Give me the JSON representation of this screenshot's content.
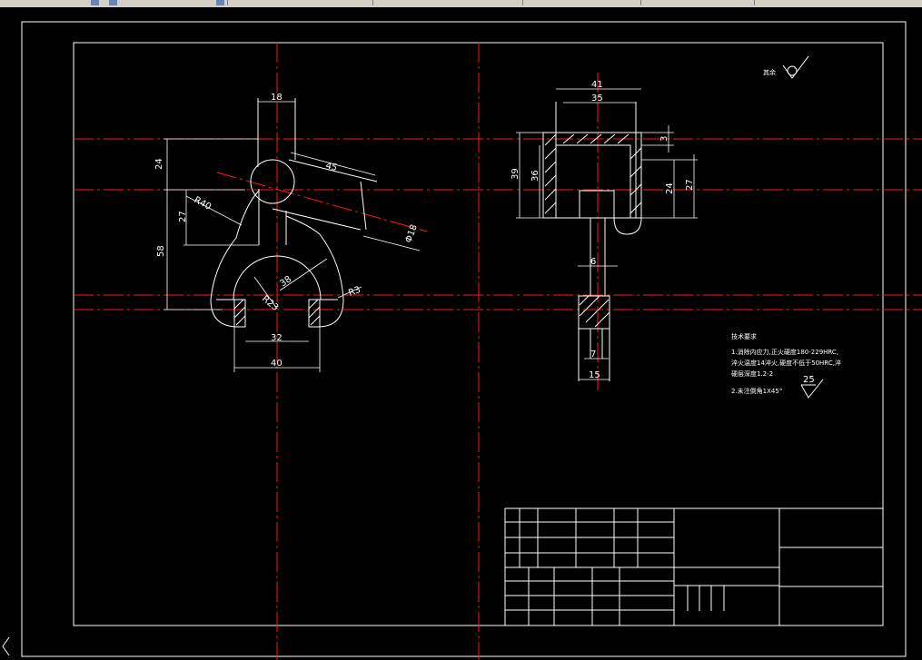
{
  "colors": {
    "background": "#000000",
    "lines": "#ffffff",
    "centerlines": "#ff1a1a",
    "hatch": "#ffffff"
  },
  "front_view": {
    "dims": {
      "d18": "18",
      "d24": "24",
      "d27": "27",
      "d58": "58",
      "d45": "45",
      "r40": "R40",
      "phi18": "Φ18",
      "d38": "38",
      "r23": "R23",
      "r3": "R3",
      "d32": "32",
      "d40": "40"
    }
  },
  "side_view": {
    "dims": {
      "d41": "41",
      "d35": "35",
      "d39": "39",
      "d36": "36",
      "d3": "3",
      "d24": "24",
      "d27": "27",
      "d6": "6",
      "d7": "7",
      "d15": "15"
    }
  },
  "roughness": {
    "label": "其余",
    "value": "25"
  },
  "tech_requirements": {
    "title": "技术要求",
    "line1": "1.消除内应力,正火硬度180-229HRC,",
    "line2": "淬火温度14淬火,硬度不低于50HRC,淬",
    "line3": "硬层深度1.2-2",
    "line4": "2.未注倒角1X45°"
  },
  "icons": {
    "ucs": "ucs-icon"
  }
}
